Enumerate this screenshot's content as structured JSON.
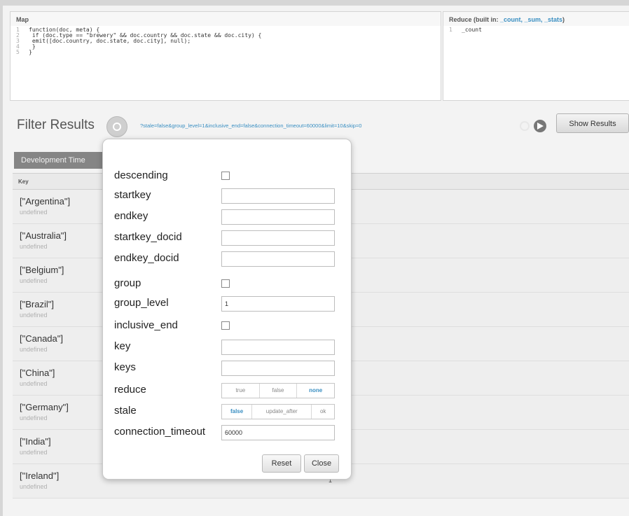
{
  "map": {
    "title": "Map",
    "code_lines": [
      {
        "n": "1",
        "text": "function(doc, meta) {"
      },
      {
        "n": "2",
        "text": "  if (doc.type == \"brewery\" && doc.country && doc.state &&  doc.city) {"
      },
      {
        "n": "3",
        "text": "    emit([doc.country, doc.state, doc.city], null);"
      },
      {
        "n": "4",
        "text": "  }"
      },
      {
        "n": "5",
        "text": "}"
      }
    ]
  },
  "reduce": {
    "title": "Reduce (built in: ",
    "builtins": "_count, _sum, _stats",
    "title_end": ")",
    "code_line_number": "1",
    "code_text": "_count"
  },
  "filter": {
    "title": "Filter Results",
    "query_string": "?stale=false&group_level=1&inclusive_end=false&connection_timeout=60000&limit=10&skip=0",
    "show_results_label": "Show Results"
  },
  "tabs": {
    "development_label": "Development Time"
  },
  "table": {
    "key_header": "Key",
    "rows": [
      {
        "key": "[\"Argentina\"]",
        "value": "undefined"
      },
      {
        "key": "[\"Australia\"]",
        "value": "undefined"
      },
      {
        "key": "[\"Belgium\"]",
        "value": "undefined"
      },
      {
        "key": "[\"Brazil\"]",
        "value": "undefined"
      },
      {
        "key": "[\"Canada\"]",
        "value": "undefined"
      },
      {
        "key": "[\"China\"]",
        "value": "undefined"
      },
      {
        "key": "[\"Germany\"]",
        "value": "undefined"
      },
      {
        "key": "[\"India\"]",
        "value": "undefined"
      },
      {
        "key": "[\"Ireland\"]",
        "value": "undefined",
        "count": "1"
      }
    ]
  },
  "popover": {
    "descending": "descending",
    "startkey": "startkey",
    "endkey": "endkey",
    "startkey_docid": "startkey_docid",
    "endkey_docid": "endkey_docid",
    "group": "group",
    "group_level": "group_level",
    "group_level_value": "1",
    "inclusive_end": "inclusive_end",
    "key": "key",
    "keys": "keys",
    "reduce": "reduce",
    "reduce_options": [
      "true",
      "false",
      "none"
    ],
    "reduce_selected": "none",
    "stale": "stale",
    "stale_options": [
      "false",
      "update_after",
      "ok"
    ],
    "stale_selected": "false",
    "connection_timeout": "connection_timeout",
    "connection_timeout_value": "60000",
    "reset_label": "Reset",
    "close_label": "Close"
  },
  "colors": {
    "accent": "#3a8fc2",
    "tab_active": "#858585"
  }
}
